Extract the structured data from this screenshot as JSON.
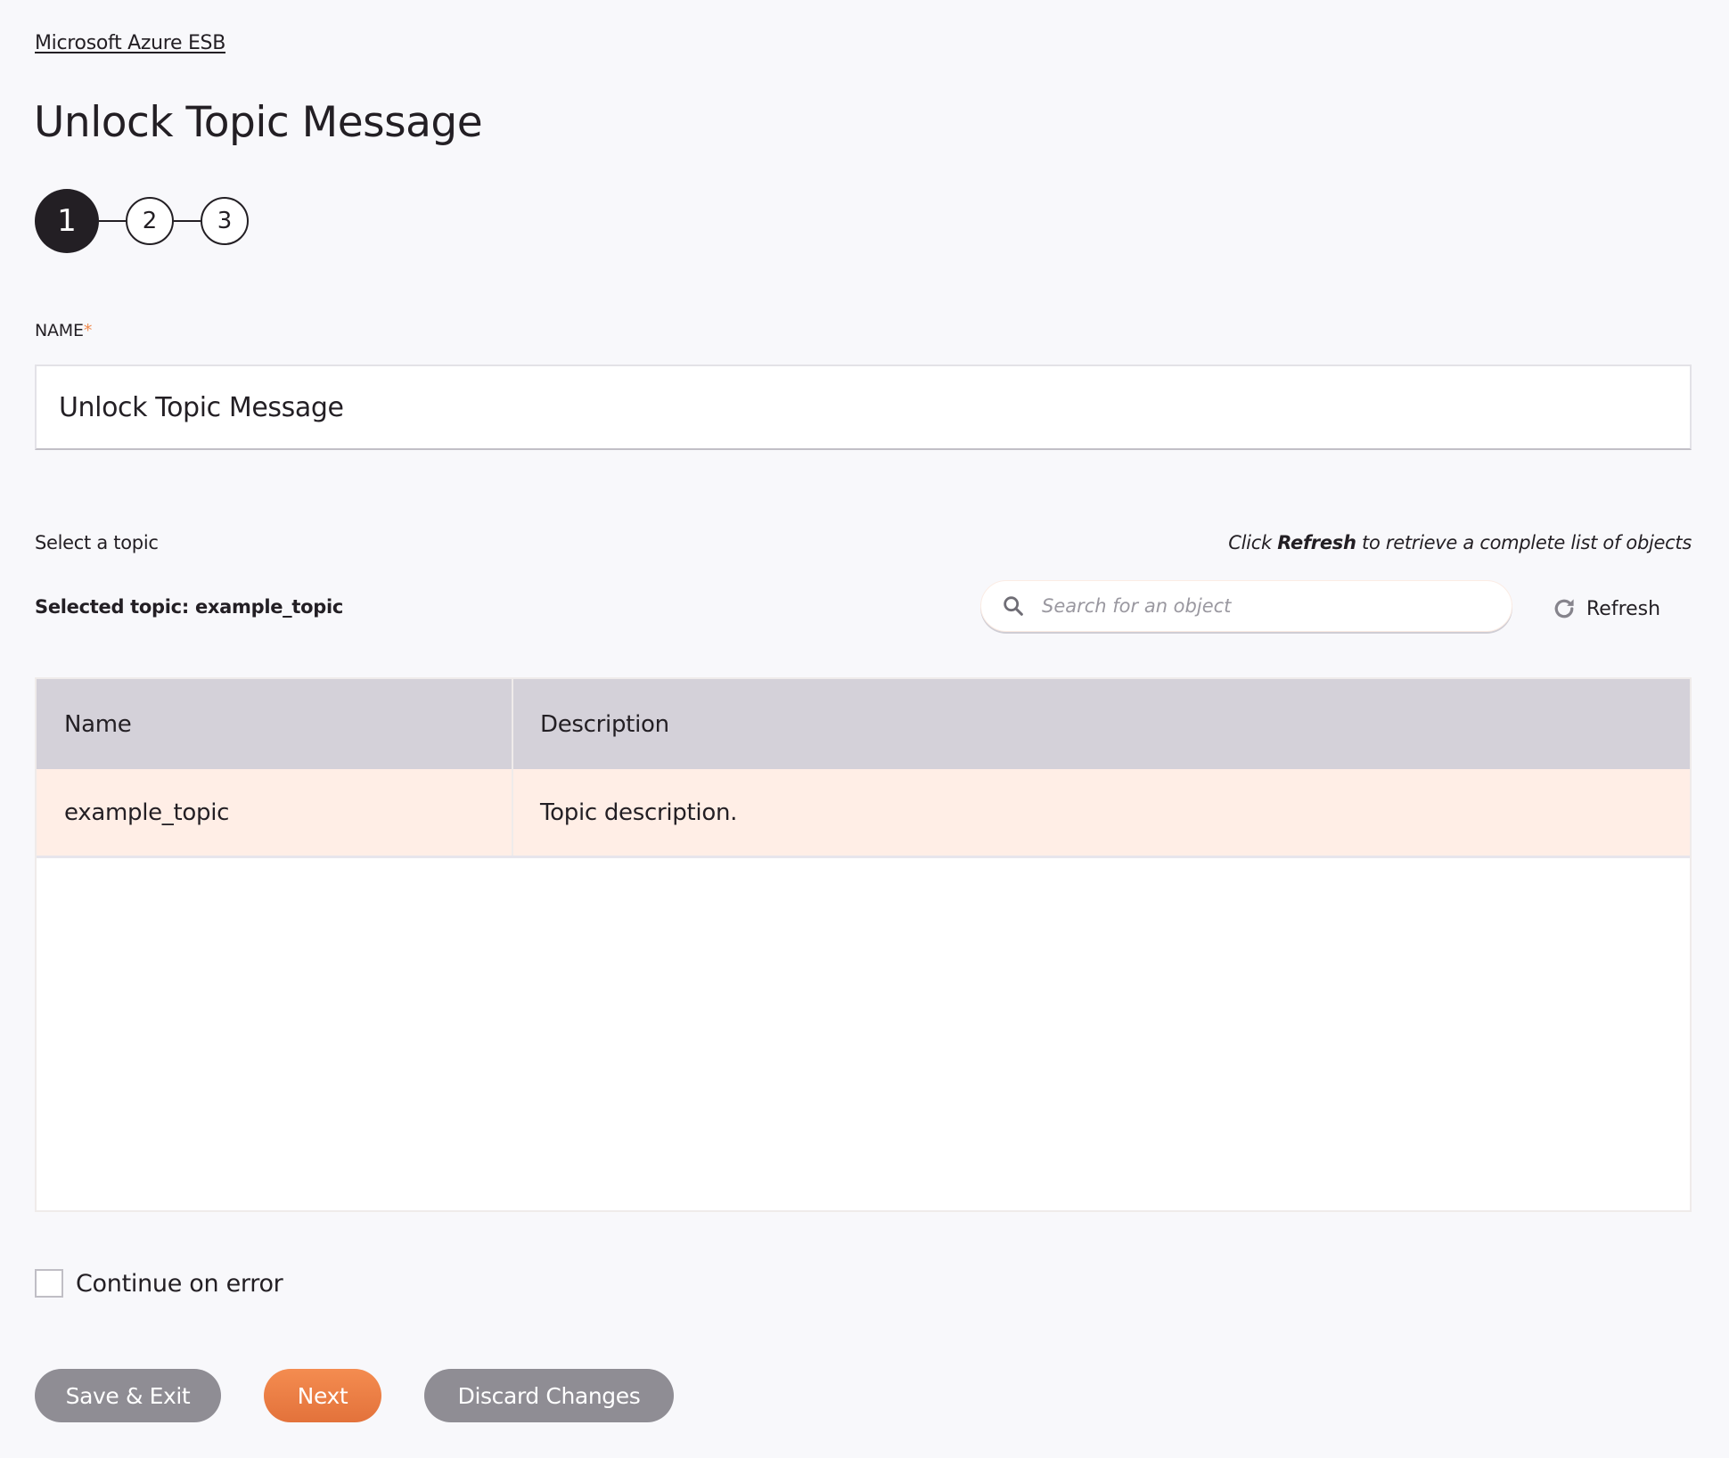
{
  "breadcrumb": {
    "label": "Microsoft Azure ESB"
  },
  "page": {
    "title": "Unlock Topic Message"
  },
  "stepper": {
    "steps": [
      {
        "label": "1",
        "state": "active"
      },
      {
        "label": "2",
        "state": "inactive"
      },
      {
        "label": "3",
        "state": "inactive"
      }
    ],
    "current_step": 1
  },
  "name_field": {
    "label": "NAME",
    "required_mark": "*",
    "value": "Unlock Topic Message"
  },
  "topic_selection": {
    "label": "Select a topic",
    "selected_prefix": "Selected topic:",
    "selected_value": "example_topic",
    "hint": {
      "before": "Click ",
      "emphasis": "Refresh",
      "after": " to retrieve a complete list of objects"
    },
    "search": {
      "placeholder": "Search for an object",
      "value": "",
      "icon": "search-icon"
    },
    "refresh": {
      "label": "Refresh",
      "icon": "refresh-icon"
    }
  },
  "table": {
    "columns": [
      "Name",
      "Description"
    ],
    "rows": [
      {
        "name": "example_topic",
        "description": "Topic description.",
        "selected": true
      }
    ]
  },
  "options": {
    "continue_on_error": {
      "label": "Continue on error",
      "checked": false
    }
  },
  "footer": {
    "save_exit_label": "Save & Exit",
    "next_label": "Next",
    "discard_label": "Discard Changes"
  },
  "colors": {
    "accent": "#e97d45",
    "required": "#ef8a4e",
    "selected_row": "#ffeee6",
    "table_header": "#d4d1d9",
    "secondary_button": "#8f8d94",
    "text": "#231f24",
    "background": "#f8f8fb"
  }
}
